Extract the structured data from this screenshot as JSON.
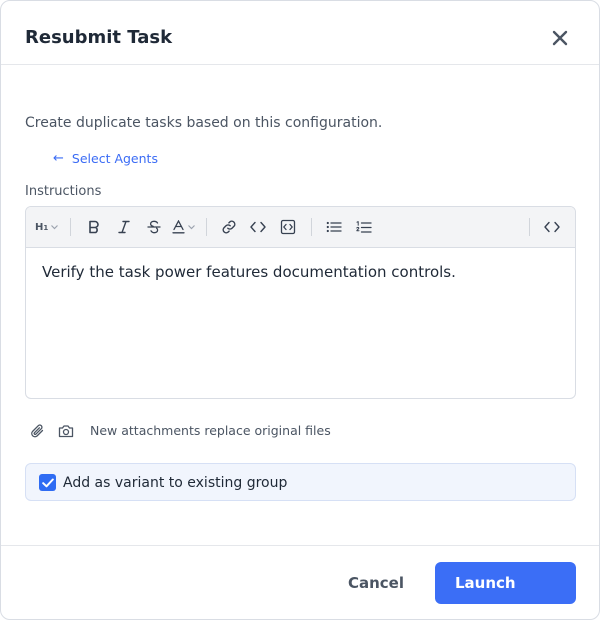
{
  "dialog": {
    "title": "Resubmit Task",
    "close_icon": "close-icon"
  },
  "intro_text": "Create duplicate tasks based on this configuration.",
  "agents_link": {
    "arrow": "←",
    "label": "Select Agents"
  },
  "instructions": {
    "label": "Instructions",
    "content": "Verify the task power features documentation controls.",
    "toolbar": {
      "heading": "H",
      "heading_sub": "1",
      "tools": [
        "heading-dropdown",
        "bold-icon",
        "italic-icon",
        "strikethrough-icon",
        "text-color-icon",
        "link-icon",
        "inline-code-icon",
        "code-block-icon",
        "bullet-list-icon",
        "numbered-list-icon",
        "source-code-icon"
      ]
    }
  },
  "attachments": {
    "note": "New attachments replace original files",
    "icons": [
      "paperclip-icon",
      "camera-icon"
    ]
  },
  "variant": {
    "label": "Add as variant to existing group",
    "checked": true
  },
  "footer": {
    "cancel_label": "Cancel",
    "launch_label": "Launch"
  },
  "colors": {
    "accent": "#3b6ef6",
    "link": "#3b6cf5",
    "variant_bg": "#f1f5fd"
  }
}
